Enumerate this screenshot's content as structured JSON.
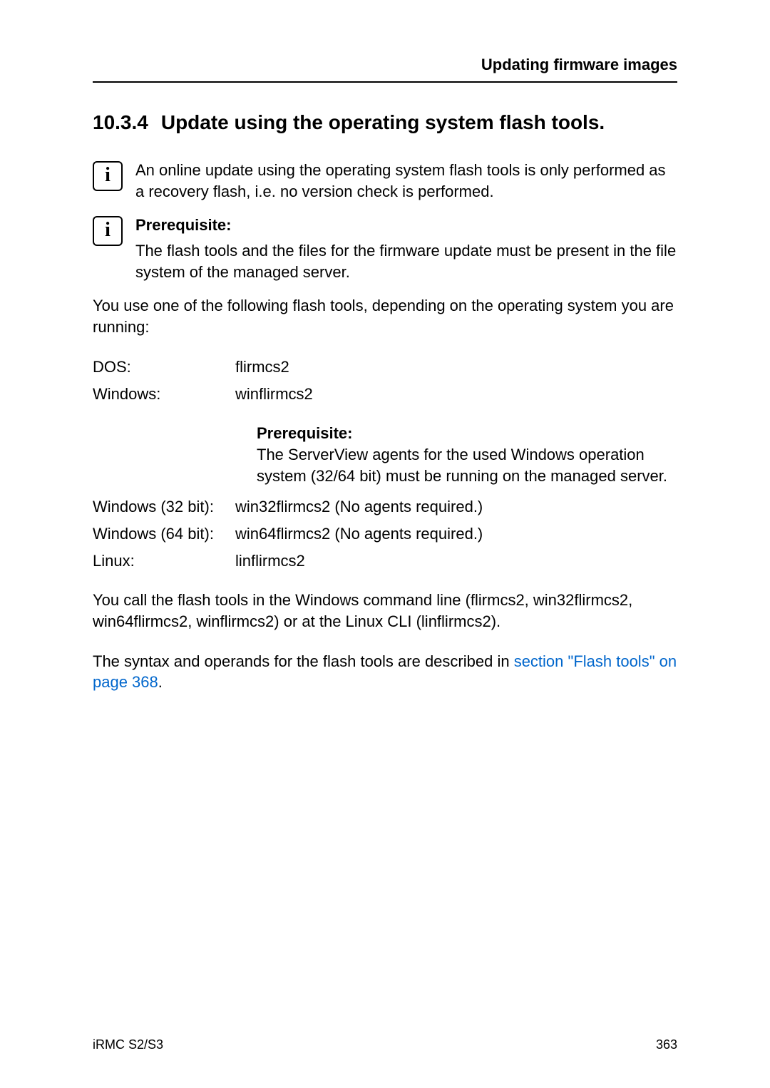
{
  "header": {
    "running_title": "Updating firmware images"
  },
  "section": {
    "number": "10.3.4",
    "title": "Update using the operating system flash tools."
  },
  "info1": {
    "text": "An online update using the operating system flash tools is only performed as a recovery flash, i.e. no version check is performed."
  },
  "info2": {
    "heading": "Prerequisite:",
    "text": "The flash tools and the files for the firmware update must be present in the file system of the managed server."
  },
  "intro_para": "You use one of the following flash tools, depending on the operating system you are running:",
  "tools": {
    "row1": {
      "label": "DOS:",
      "value": "flirmcs2"
    },
    "row2": {
      "label": "Windows:",
      "value": "winflirmcs2"
    },
    "win_prereq_heading": "Prerequisite:",
    "win_prereq_text": "The ServerView agents for the used Windows operation system (32/64 bit) must be running on the managed server.",
    "row3": {
      "label": "Windows (32 bit):",
      "value": "win32flirmcs2 (No agents required.)"
    },
    "row4": {
      "label": "Windows (64 bit):",
      "value": "win64flirmcs2 (No agents required.)"
    },
    "row5": {
      "label": "Linux:",
      "value": "linflirmcs2"
    }
  },
  "call_para": "You call the flash tools in the Windows command line (flirmcs2, win32flirmcs2, win64flirmcs2, winflirmcs2) or at the Linux CLI (linflirmcs2).",
  "syntax_para_prefix": "The syntax and operands for the flash tools are described in ",
  "syntax_link": "section \"Flash tools\" on page 368",
  "syntax_para_suffix": ".",
  "footer": {
    "left": "iRMC S2/S3",
    "right": "363"
  }
}
